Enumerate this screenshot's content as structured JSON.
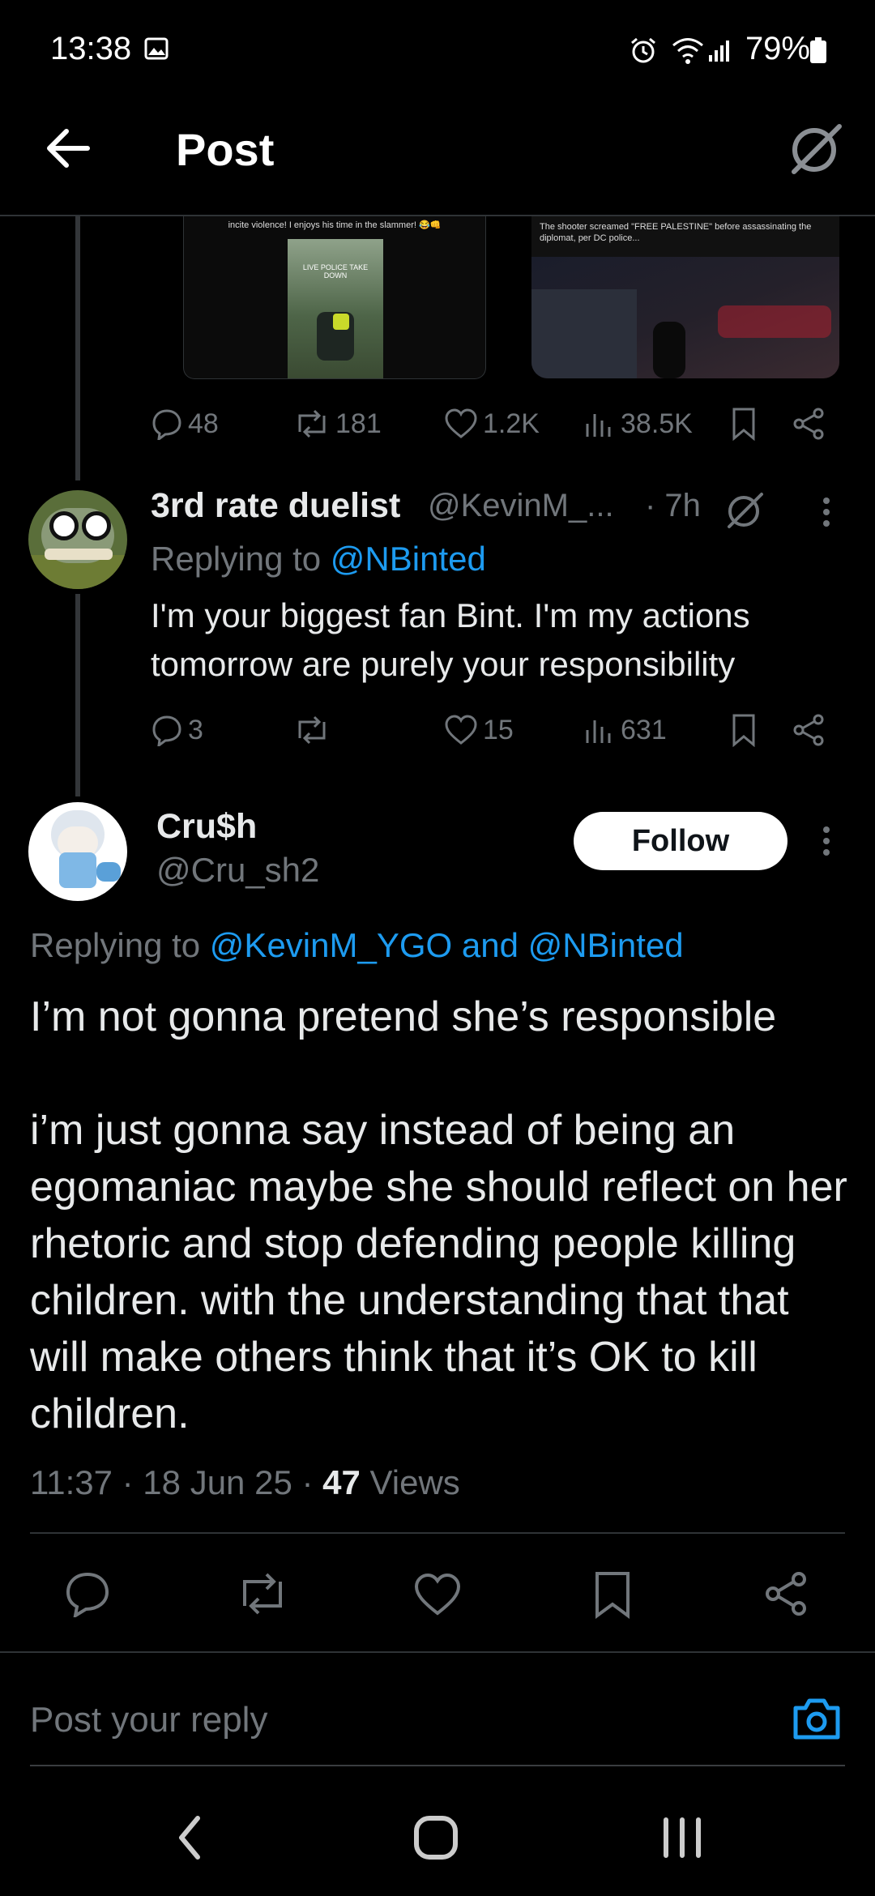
{
  "status_bar": {
    "time": "13:38",
    "battery": "79%"
  },
  "header": {
    "title": "Post"
  },
  "quoted_media": {
    "left_caption": "incite violence! I enjoys his time in the slammer! 😂👊",
    "left_overlay": "LIVE POLICE TAKE DOWN",
    "right_caption": "The shooter screamed \"FREE PALESTINE\" before assassinating the diplomat, per DC police..."
  },
  "first_post_stats": {
    "replies": "48",
    "reposts": "181",
    "likes": "1.2K",
    "views": "38.5K"
  },
  "reply1": {
    "display_name": "3rd rate duelist",
    "handle": "@KevinM_...",
    "time": "· 7h",
    "replying_prefix": "Replying to",
    "replying_to": "@NBinted",
    "text": "I'm  your biggest fan Bint. I'm my actions tomorrow are purely your responsibility",
    "stats": {
      "replies": "3",
      "reposts": "",
      "likes": "15",
      "views": "631"
    }
  },
  "main_post": {
    "display_name": "Cru$h",
    "handle": "@Cru_sh2",
    "follow_label": "Follow",
    "replying_prefix": "Replying to",
    "replying_to": "@KevinM_YGO and @NBinted",
    "text": "I’m not gonna pretend she’s responsible\n\ni’m just gonna say instead of being an egomaniac maybe she should reflect on her rhetoric and stop defending people killing children. with the understanding that that will make others think that it’s OK to kill children.",
    "timestamp": "11:37 · 18 Jun 25 ·",
    "views_count": "47",
    "views_label": "Views"
  },
  "reply_box": {
    "placeholder": "Post your reply"
  },
  "colors": {
    "accent": "#1d9bf0",
    "muted": "#71767b",
    "background": "#000000"
  }
}
